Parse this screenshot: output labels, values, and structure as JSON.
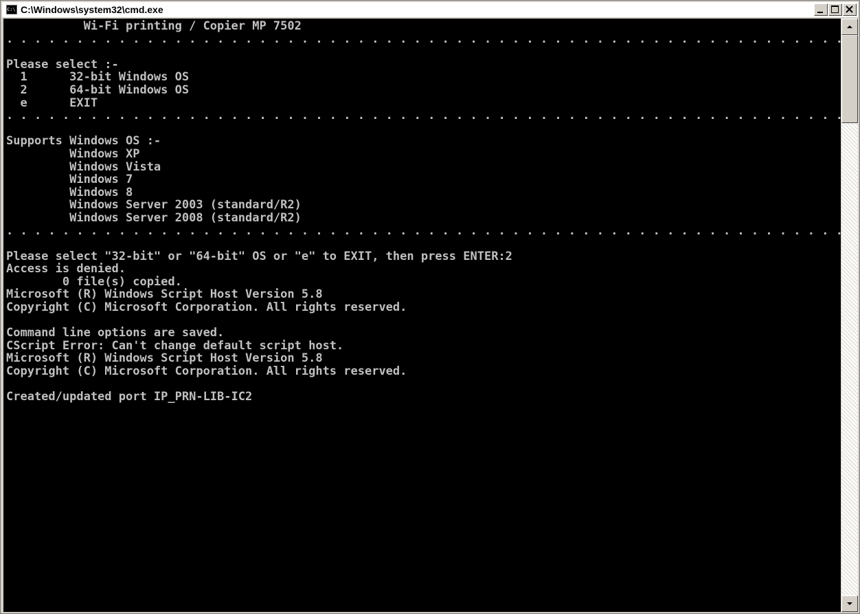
{
  "window": {
    "title": "C:\\Windows\\system32\\cmd.exe",
    "icon_label": "C:\\.",
    "icon": "console-window-icon",
    "controls": {
      "minimize": "minimize-icon",
      "maximize": "maximize-icon",
      "close": "close-icon"
    }
  },
  "console": {
    "text": "           Wi-Fi printing / Copier MP 7502\n. . . . . . . . . . . . . . . . . . . . . . . . . . . . . . . . . . . . . . . . . . . . . . . . . . . . . . . . . . . . . . . . . . . . . . . . . . . . . . . . . .\n\nPlease select :-\n  1      32-bit Windows OS\n  2      64-bit Windows OS\n  e      EXIT\n. . . . . . . . . . . . . . . . . . . . . . . . . . . . . . . . . . . . . . . . . . . . . . . . . . . . . . . . . . . . . . . . . . . . . . . . . . . . . . . . . .\n\nSupports Windows OS :-\n         Windows XP\n         Windows Vista\n         Windows 7\n         Windows 8\n         Windows Server 2003 (standard/R2)\n         Windows Server 2008 (standard/R2)\n. . . . . . . . . . . . . . . . . . . . . . . . . . . . . . . . . . . . . . . . . . . . . . . . . . . . . . . . . . . . . . . . . . . . . . . . . . . . . . . . . .\n\nPlease select \"32-bit\" or \"64-bit\" OS or \"e\" to EXIT, then press ENTER:2\nAccess is denied.\n        0 file(s) copied.\nMicrosoft (R) Windows Script Host Version 5.8\nCopyright (C) Microsoft Corporation. All rights reserved.\n\nCommand line options are saved.\nCScript Error: Can't change default script host.\nMicrosoft (R) Windows Script Host Version 5.8\nCopyright (C) Microsoft Corporation. All rights reserved.\n\nCreated/updated port IP_PRN-LIB-IC2",
    "colors": {
      "background": "#000000",
      "foreground": "#c0c0c0"
    }
  },
  "scrollbar": {
    "up": "scroll-up-arrow-icon",
    "down": "scroll-down-arrow-icon"
  }
}
